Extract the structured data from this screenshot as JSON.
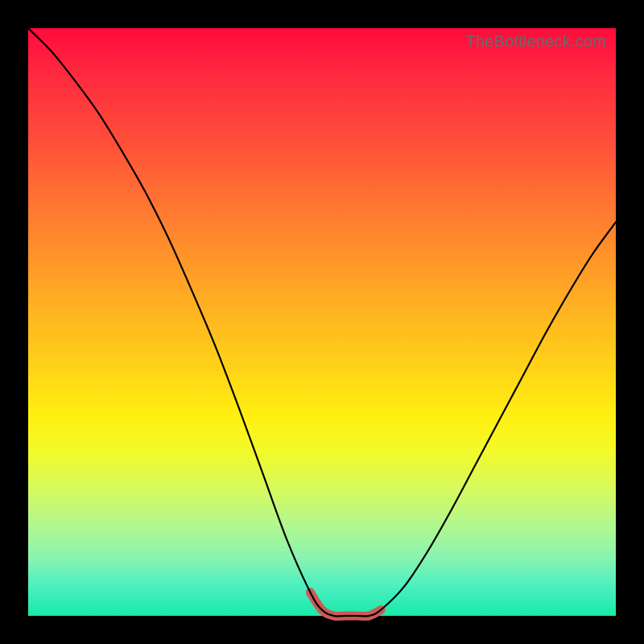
{
  "watermark": "TheBottleneck.com",
  "colors": {
    "frame": "#000000",
    "curve": "#000000",
    "trough_highlight": "#cc5a55"
  },
  "chart_data": {
    "type": "line",
    "title": "",
    "xlabel": "",
    "ylabel": "",
    "xlim": [
      0,
      100
    ],
    "ylim": [
      0,
      100
    ],
    "grid": false,
    "legend": false,
    "series": [
      {
        "name": "bottleneck-curve",
        "x": [
          0,
          4,
          8,
          12,
          16,
          20,
          24,
          28,
          32,
          36,
          40,
          44,
          48,
          50,
          52,
          54,
          56,
          58,
          60,
          64,
          68,
          72,
          76,
          80,
          84,
          88,
          92,
          96,
          100
        ],
        "values": [
          100,
          96,
          91,
          85.5,
          79,
          72,
          64,
          55,
          45.5,
          35,
          24,
          13,
          4,
          1,
          0,
          0,
          0,
          0,
          1,
          5,
          11,
          18,
          25.5,
          33,
          40.5,
          48,
          55,
          61.5,
          67
        ]
      }
    ],
    "annotations": [
      {
        "name": "optimal-range-highlight",
        "kind": "segment-overlay",
        "x_start": 48,
        "x_end": 60,
        "note": "thick salmon stroke over the flat trough"
      }
    ]
  }
}
